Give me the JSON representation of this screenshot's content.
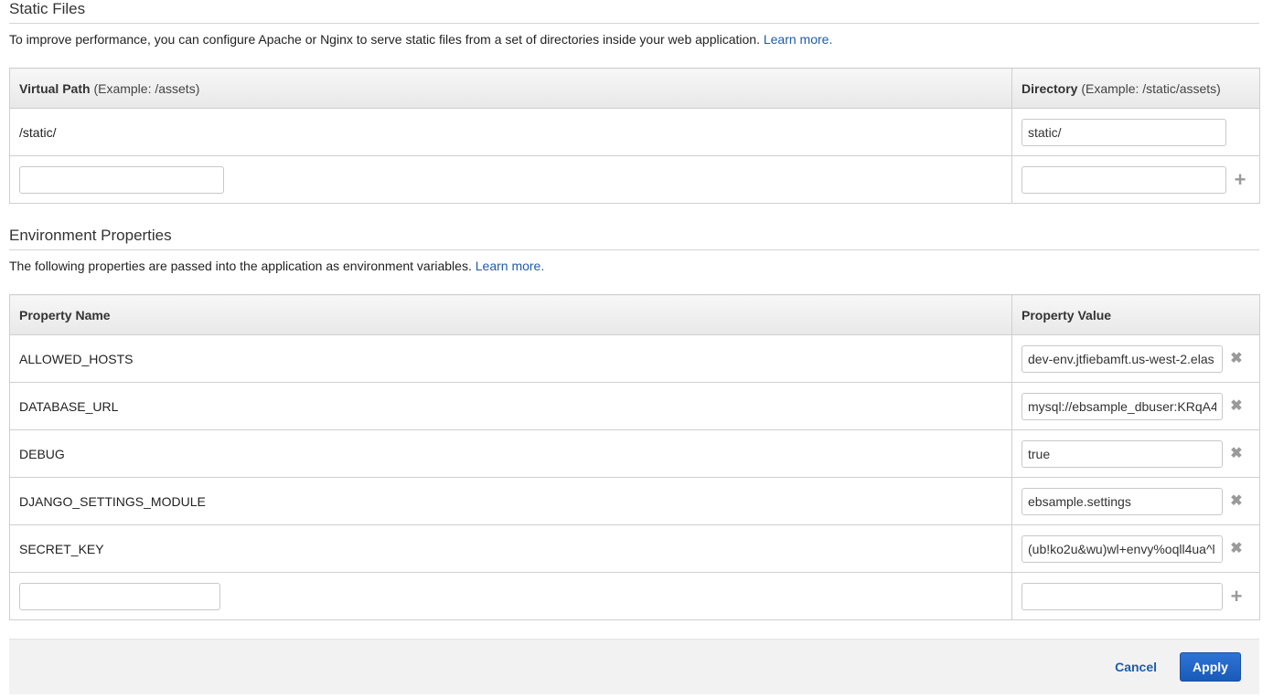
{
  "static_files": {
    "title": "Static Files",
    "description": "To improve performance, you can configure Apache or Nginx to serve static files from a set of directories inside your web application.",
    "learn_more": "Learn more.",
    "col1_label": "Virtual Path",
    "col1_hint": "(Example: /assets)",
    "col2_label": "Directory",
    "col2_hint": "(Example: /static/assets)",
    "rows": [
      {
        "path": "/static/",
        "directory": "static/"
      }
    ],
    "new_row": {
      "path": "",
      "directory": ""
    }
  },
  "environment": {
    "title": "Environment Properties",
    "description": "The following properties are passed into the application as environment variables.",
    "learn_more": "Learn more.",
    "col1_label": "Property Name",
    "col2_label": "Property Value",
    "rows": [
      {
        "name": "ALLOWED_HOSTS",
        "value": "dev-env.jtfiebamft.us-west-2.elas"
      },
      {
        "name": "DATABASE_URL",
        "value": "mysql://ebsample_dbuser:KRqA4"
      },
      {
        "name": "DEBUG",
        "value": "true"
      },
      {
        "name": "DJANGO_SETTINGS_MODULE",
        "value": "ebsample.settings"
      },
      {
        "name": "SECRET_KEY",
        "value": "(ub!ko2u&wu)wl+envy%oqll4ua^l"
      }
    ],
    "new_row": {
      "name": "",
      "value": ""
    }
  },
  "icons": {
    "remove": "remove-x-icon",
    "add": "add-plus-icon"
  },
  "footer": {
    "cancel_label": "Cancel",
    "apply_label": "Apply"
  },
  "colors": {
    "link": "#1f5ca8",
    "apply_button": "#1f63c6",
    "icon": "#9a9a9a"
  }
}
